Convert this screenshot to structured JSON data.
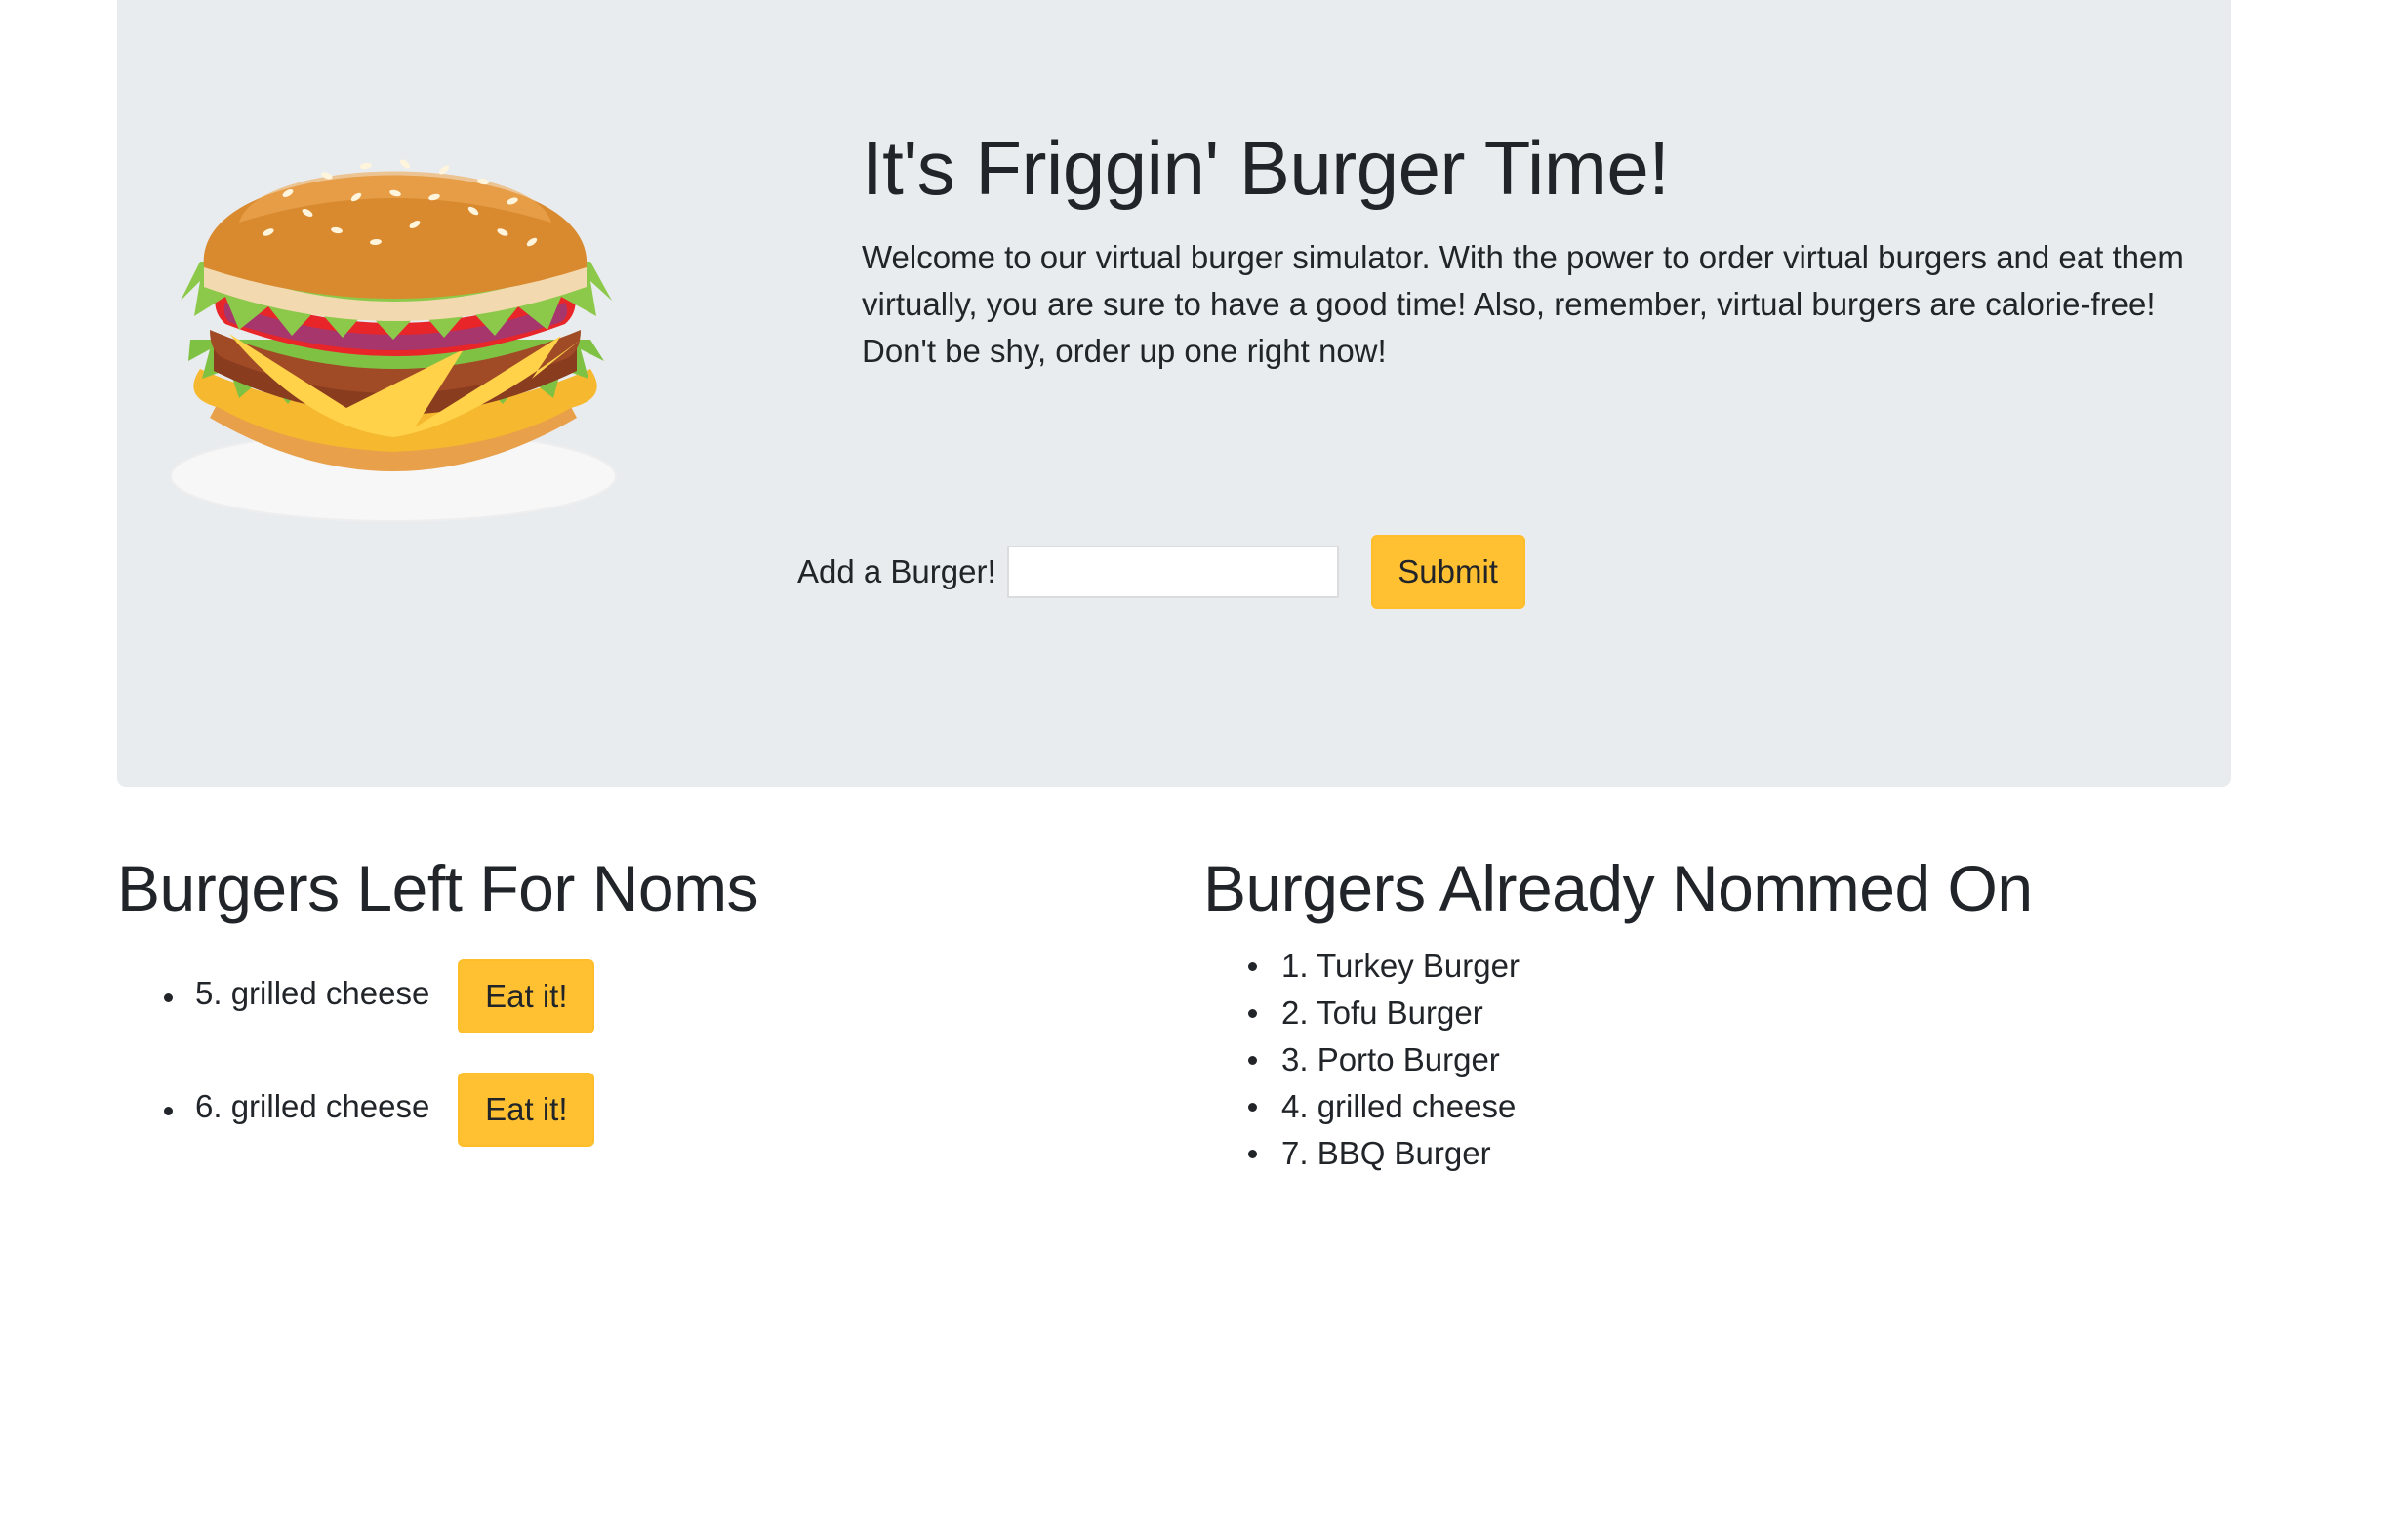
{
  "header": {
    "title": "It's Friggin' Burger Time!",
    "description": "Welcome to our virtual burger simulator. With the power to order virtual burgers and eat them virtually, you are sure to have a good time! Also, remember, virtual burgers are calorie-free! Don't be shy, order up one right now!"
  },
  "form": {
    "label": "Add a Burger!",
    "input_value": "",
    "submit_label": "Submit"
  },
  "left": {
    "title": "Burgers Left For Noms",
    "eat_label": "Eat it!",
    "items": [
      "5. grilled cheese",
      "6. grilled cheese"
    ]
  },
  "right": {
    "title": "Burgers Already Nommed On",
    "items": [
      "1. Turkey Burger",
      "2. Tofu Burger",
      "3. Porto Burger",
      "4. grilled cheese",
      "7. BBQ Burger"
    ]
  },
  "colors": {
    "jumbotron": "#e9ecef",
    "button": "#ffc131",
    "text": "#212529"
  }
}
